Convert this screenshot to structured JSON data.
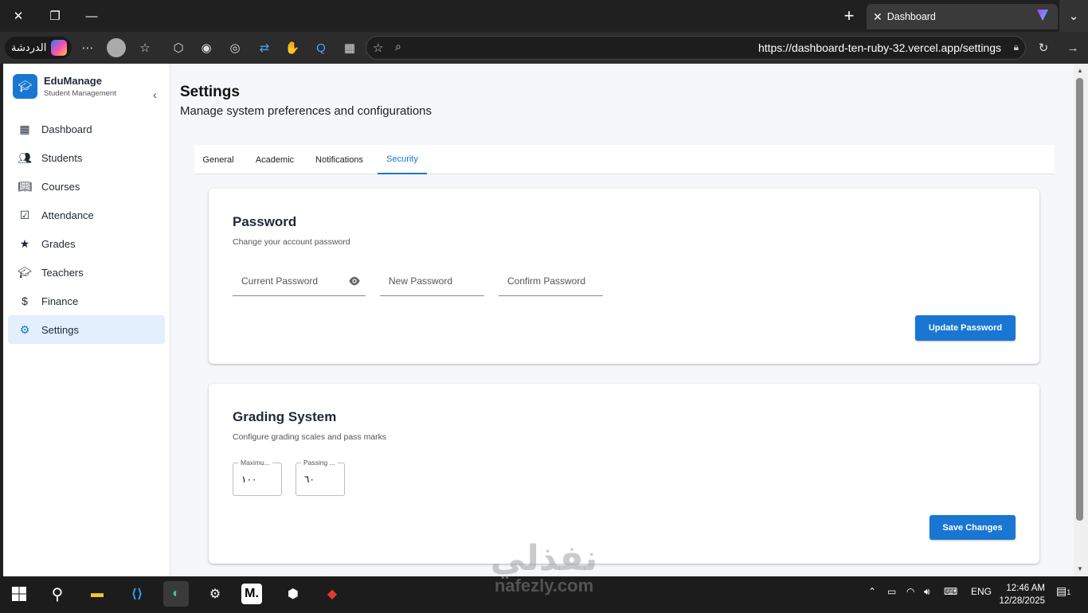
{
  "browser": {
    "tab_title": "Dashboard",
    "url": "https://dashboard-ten-ruby-32.vercel.app/settings",
    "chat_label": "الدردشة"
  },
  "sidebar": {
    "brand_name": "EduManage",
    "brand_sub": "Student Management",
    "items": [
      {
        "label": "Dashboard",
        "icon": "dashboard-icon"
      },
      {
        "label": "Students",
        "icon": "people-icon"
      },
      {
        "label": "Courses",
        "icon": "book-icon"
      },
      {
        "label": "Attendance",
        "icon": "calendar-check-icon"
      },
      {
        "label": "Grades",
        "icon": "star-icon"
      },
      {
        "label": "Teachers",
        "icon": "school-icon"
      },
      {
        "label": "Finance",
        "icon": "dollar-icon"
      },
      {
        "label": "Settings",
        "icon": "gear-icon",
        "active": true
      }
    ]
  },
  "main": {
    "title": "Settings",
    "subtitle": "Manage system preferences and configurations",
    "tabs": [
      {
        "label": "General"
      },
      {
        "label": "Academic"
      },
      {
        "label": "Notifications"
      },
      {
        "label": "Security",
        "active": true
      }
    ],
    "password_card": {
      "title": "Password",
      "subtitle": "Change your account password",
      "current_placeholder": "Current Password",
      "new_placeholder": "New Password",
      "confirm_placeholder": "Confirm Password",
      "button": "Update Password"
    },
    "grading_card": {
      "title": "Grading System",
      "subtitle": "Configure grading scales and pass marks",
      "max_label": "Maximu...",
      "max_value": "١٠٠",
      "pass_label": "Passing ...",
      "pass_value": "٦٠",
      "button": "Save Changes"
    }
  },
  "watermark": {
    "arabic": "نفذلي",
    "latin": "nafezly.com"
  },
  "taskbar": {
    "lang": "ENG",
    "time": "12:46 AM",
    "date": "12/28/2025",
    "notif_count": "1"
  },
  "colors": {
    "accent": "#1976d2",
    "active_nav_bg": "#e3effc"
  }
}
